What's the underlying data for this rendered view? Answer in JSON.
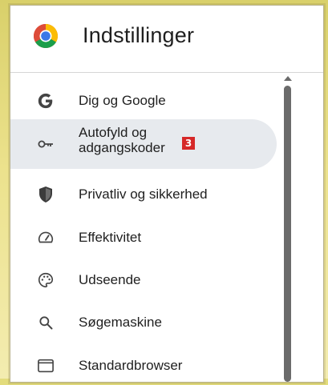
{
  "header": {
    "title": "Indstillinger",
    "logo_icon": "chrome-logo-icon"
  },
  "nav": {
    "items": [
      {
        "label": "Dig og Google",
        "icon": "google-g-icon"
      },
      {
        "label": "Autofyld og adgangskoder",
        "icon": "key-icon",
        "badge": "3",
        "active": true
      },
      {
        "label": "Privatliv og sikkerhed",
        "icon": "shield-icon"
      },
      {
        "label": "Effektivitet",
        "icon": "speedometer-icon"
      },
      {
        "label": "Udseende",
        "icon": "palette-icon"
      },
      {
        "label": "Søgemaskine",
        "icon": "search-icon"
      },
      {
        "label": "Standardbrowser",
        "icon": "browser-window-icon"
      }
    ]
  },
  "colors": {
    "active_bg": "#e7eaee",
    "badge": "#d62828",
    "text": "#1f1f1f",
    "background_frame": "#e3dc7c"
  }
}
